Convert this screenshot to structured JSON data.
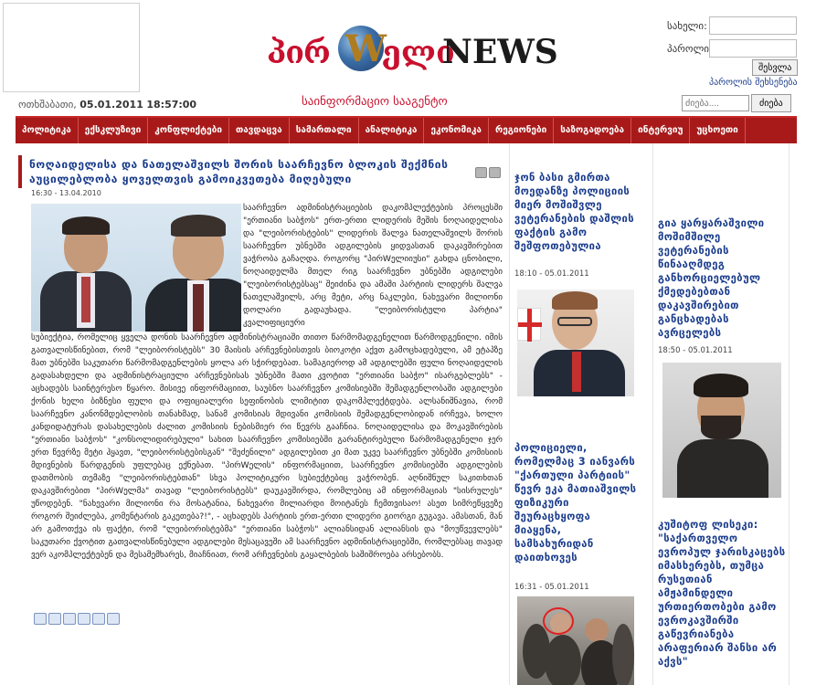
{
  "header": {
    "logo_part1": "პირ",
    "logo_w": "W",
    "logo_part2": "ელი",
    "logo_news": "NEWS",
    "tagline": "საინფორმაციო სააგენტო",
    "date_label": "ოთხშაბათი,",
    "date_value": "05.01.2011",
    "time_value": "18:57:00"
  },
  "login": {
    "user_label": "სახელი:",
    "pass_label": "პაროლი:",
    "submit_label": "შესვლა",
    "forgot_label": "პაროლის შეხსენება"
  },
  "search": {
    "placeholder": "ძიება....",
    "button_label": "ძიება"
  },
  "nav": {
    "items": [
      "პოლიტიკა",
      "ექსკლუზივი",
      "კონფლიქტები",
      "თავდაცვა",
      "სამართალი",
      "ანალიტიკა",
      "ეკონომიკა",
      "რეგიონები",
      "საზოგადოება",
      "ინტერვიუ",
      "უცხოეთი"
    ]
  },
  "article": {
    "headline": "ნოღაიდელისა და ნათელაშვილს შორის საარჩევნო ბლოკის შექმნის აუცილებლობა ყოველთვის გამოიკვეთება მიღებული",
    "date": "16:30 - 13.04.2010",
    "body_top": "საარჩევნო ადმინისტრაციების დაკომპლექტების პროცესში \"ერთიანი საბჭოს\" ერთ-ერთი ლიდერის მეშის ნოღაიდელისა და \"ლეიბორისტების\" ლიდერის შალვა ნათელაშვილს შორის საარჩევნო უბნებში ადგილების ყიდვასთან დაკავშირებით ვაჭრობა გაჩაღდა. როგორც \"პირWელიიუსი\" გახდა ცნობილი, ნოღაიდელმა მთელ რიგ საარჩევნო უბნებში ადგილები \"ლეიბორისტებსაც\" შეიძინა და ამაში პარტიის ლიდერს შალვა ნათელაშვილს, არც მეტი, არც ნაკლები, ნახევარი მილიონი დოლარი გადაუხადა. \"ლეიბორისტული პარტია\" კვალიფიციური",
    "body_rest": "სუბიექტია, რომელიც ყველა დონის საარჩევნო ადმინისტრაციაში თითო წარმომადგენელით წარმოდგენილი. იმის გათვალისწინებით, რომ \"ლეიბორისტებს\" 30 მაისის არჩევნებისთვის ბიოკოტი აქვთ გამოცხადებული, ამ ეტაპზე მათ უბნებში საკუთარი წარმომადგენლების ყოლა არ სჭირდებათ. სამაგიეროდ ამ ადგილებში ფული ნოღაიდელის გადასახდელი და ადმინისტრაციული არჩევნებისას უბნებში მათი კვოტით \"ერთიანი საბჭო\" ისარგებლებს\" - აცხადებს საინტერესო წყარო. მისივე ინფორმაციით, საუბნო საარჩევნო კომისიებში შემადგენლობაში ადგილები ქონის ხელი ბიზნესი ფული და ოფიციალური სეფინობის ლიმიტით დაკომპლექტდება. ალსანიშნავია, რომ საარჩევნო კანონმდებლობის თანახმად, სანამ კომისიას მდივანი კომისიის შემადგენლობიდან ირჩევა, ხოლო კანდიდატურას დასახელების ძალით კომისიის ნებისმიერ რი წევრს გააჩნია. ნოღაიდელისა და მოკავშირების \"ერთიანი საბჭოს\" \"კონსოლიდირებული\" სახით საარჩევნო კომისიებში გარანტირებული წარმომადგენელი ჯერ ერთ წევრზე მეტი ჰყავთ, \"ლეიბორისტებისგან\" \"შეძენილი\" ადგილებით კი მათ უკვე საარჩევნო უბნებში კომისიის მდივნების წარდგენის უფლებაც ექნებათ. \"პირWელის\" ინფორმაციით, საარჩევნო კომისიებში ადგილების დათმობის თემაზე \"ლეიბორისტებთან\" სხვა პოლიტიკური სუბიექტებიც ვაჭრობენ. აღნიშნულ საკითხთან დაკავშირებით \"პირWელმა\" თავად \"ლეიბორისტებს\" დაუკავშირდა, რომლებიც ამ ინფორმაციას \"სისრულეს\" უწოდებენ. \"ნახევარი მილიონი რა მოსატანია, ნახევარი მილიარდი მოიტანეს ჩემთვისაო! ასეთ სიმრეწყვეზე როგორ შეიძლება, კომენტარის გაკეთება?!\", - აცხადებს პარტიის ერთ-ერთი ლიდერი გიორგი გუგავა. ამასთან, მან არ გამოთქვა ის ფაქტი, რომ \"ლეიბორისტებმა\" \"ერთიანი საბჭოს\" ალიანსიდან ალიანსის და \"მოუწვევლებს\" საკუთარი ქვოტით გათვალისწინებული ადგილები მესაცავეში ამ საარჩევნო ადმინისტრაციებში, რომლებსაც თავად ვერ აკომპლექტებენ და მესამემხარეს, მიაჩნიათ, რომ არჩევნების გაყალბების საშიშროება არსებობს."
  },
  "mid_column": {
    "news1_title": "ჯონ ბასი გმირთა მოედანზე პოლიციის მიერ მოშიშვლე ვეტერანების დაშლის ფაქტის გამო შეშფოთებულია",
    "news1_time": "18:10 - 05.01.2011",
    "news2_title": "პოლიციელი, რომელმაც 3 იანვარს \"ქართული პარტიის\" წევრ ეკა მათიაშვილს ფიზიკური შეურაცხყოფა მიაყენა, სამსახურიდან დაითხოვეს",
    "news2_time": "16:31 - 05.01.2011"
  },
  "right_column": {
    "news1_title": "გია ყარყარაშვილი მოშიმშილე ვეტერანების წინააღმდეგ განხორციელებულ ქმედებებთან დაკავშირებით განცხადებას ავრცელებს",
    "news1_time": "18:50 - 05.01.2011",
    "news2_title": "კუშიტოფ ლისეკი: \"საქართველო ევროპულ ჯარისკაცებს იმასხერებს, თუმცა რუსეთიან ამჟამინდელი ურთიერთობები გამო ევროკავშირში გაწევრიანება არაფერიარ შანსი არ აქვს\""
  },
  "colors": {
    "brand_red": "#a81a1a",
    "link_blue": "#1a3c8c"
  }
}
